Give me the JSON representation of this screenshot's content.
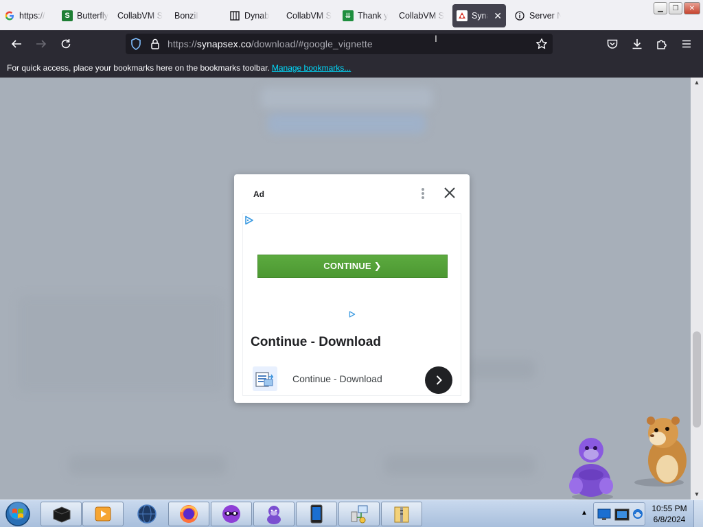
{
  "browser": {
    "tabs": [
      {
        "label": "https://",
        "favicon": "google-g-icon",
        "active": false
      },
      {
        "label": "Butterfly",
        "favicon": "s-green-icon",
        "active": false
      },
      {
        "label": "CollabVM S",
        "favicon": "none",
        "active": false
      },
      {
        "label": "BonziI",
        "favicon": "none",
        "active": false
      },
      {
        "label": "Dynab",
        "favicon": "columns-icon",
        "active": false
      },
      {
        "label": "CollabVM S",
        "favicon": "none",
        "active": false
      },
      {
        "label": "Thank y",
        "favicon": "download-green-icon",
        "active": false
      },
      {
        "label": "CollabVM S",
        "favicon": "none",
        "active": false
      },
      {
        "label": "Syna",
        "favicon": "synapse-icon",
        "active": true
      },
      {
        "label": "Server N",
        "favicon": "info-icon",
        "active": false
      }
    ],
    "url": {
      "prefix": "https://",
      "host": "synapsex.co",
      "path": "/download/#google_vignette"
    },
    "bookmarks_bar": {
      "text": "For quick access, place your bookmarks here on the bookmarks toolbar.",
      "link": "Manage bookmarks..."
    }
  },
  "ad_dialog": {
    "label": "Ad",
    "cta_button": "CONTINUE ❯",
    "headline": "Continue - Download",
    "subtitle": "Continue - Download"
  },
  "taskbar": {
    "clock_time": "10:55 PM",
    "clock_date": "6/8/2024"
  },
  "colors": {
    "tab_bar_bg": "#f0f0f4",
    "toolbar_bg": "#2b2a33",
    "url_bg": "#1c1b22",
    "link": "#00ddff",
    "cta_green": "#4c9832",
    "overlay": "#a7afb9"
  }
}
